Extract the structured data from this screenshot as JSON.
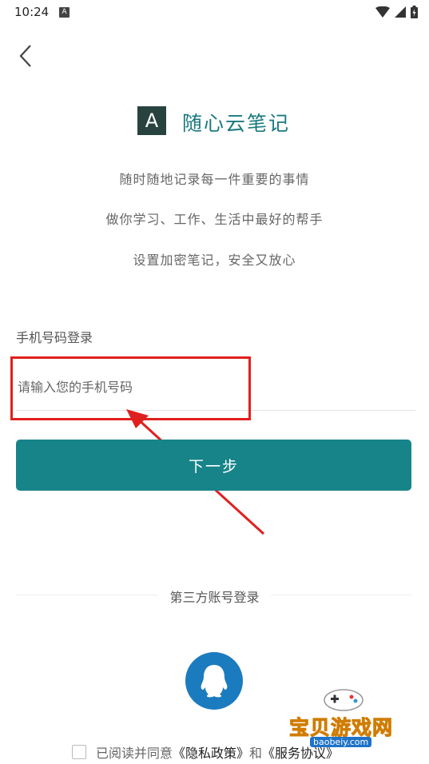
{
  "status_bar": {
    "time": "10:24",
    "notification_icon": "A"
  },
  "nav": {
    "back_icon": "chevron-left-icon"
  },
  "app": {
    "logo_letter": "A",
    "name": "随心云笔记"
  },
  "slogans": [
    "随时随地记录每一件重要的事情",
    "做你学习、工作、生活中最好的帮手",
    "设置加密笔记，安全又放心"
  ],
  "login": {
    "section_label": "手机号码登录",
    "phone_placeholder": "请输入您的手机号码",
    "phone_value": "",
    "next_button": "下一步"
  },
  "third_party": {
    "label": "第三方账号登录",
    "qq_icon": "qq-penguin-icon"
  },
  "agreement": {
    "prefix": "已阅读并同意",
    "privacy_link": "《隐私政策》",
    "and": "和",
    "service_link": "《服务协议》"
  },
  "watermark": {
    "text": "宝贝游戏网",
    "url": "baobeiy.com"
  },
  "colors": {
    "accent": "#17848a",
    "brand_text": "#1a7a80",
    "annotation": "#e0201e",
    "qq_blue": "#1b7bbf"
  }
}
